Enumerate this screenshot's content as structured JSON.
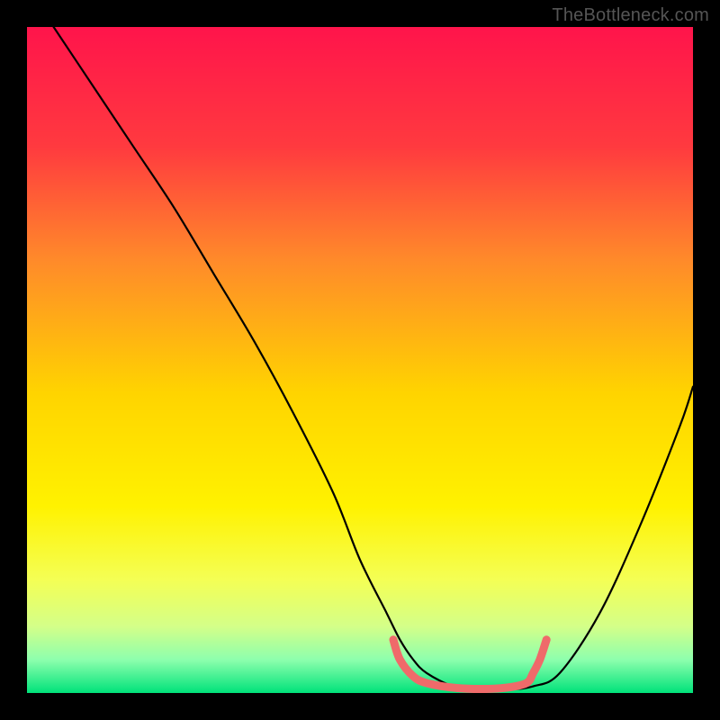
{
  "watermark": "TheBottleneck.com",
  "chart_data": {
    "type": "line",
    "title": "",
    "xlabel": "",
    "ylabel": "",
    "xlim": [
      0,
      100
    ],
    "ylim": [
      0,
      100
    ],
    "background_gradient": {
      "top": "#ff144b",
      "mid_upper": "#ff7a2a",
      "mid": "#ffe200",
      "mid_lower": "#f4ff55",
      "near_bottom": "#d4ff88",
      "bottom": "#00e27a"
    },
    "series": [
      {
        "name": "bottleneck-curve",
        "type": "line",
        "color": "#000000",
        "x": [
          4,
          10,
          16,
          22,
          28,
          34,
          40,
          46,
          50,
          54,
          56,
          58,
          60,
          64,
          68,
          72,
          76,
          80,
          86,
          92,
          98,
          100
        ],
        "y": [
          100,
          91,
          82,
          73,
          63,
          53,
          42,
          30,
          20,
          12,
          8,
          5,
          3,
          1,
          0.5,
          0.5,
          1,
          3,
          12,
          25,
          40,
          46
        ]
      },
      {
        "name": "optimal-zone-marker",
        "type": "line",
        "color": "#ef6a6a",
        "stroke_width": 9,
        "x": [
          55,
          56,
          58,
          60,
          64,
          68,
          72,
          75,
          76,
          77,
          78
        ],
        "y": [
          8,
          5,
          2.5,
          1.5,
          0.8,
          0.6,
          0.8,
          1.5,
          3,
          5,
          8
        ]
      }
    ],
    "notes": "V-shaped bottleneck curve over rainbow heat gradient; pink segment highlights the low-bottleneck region near the curve minimum."
  }
}
